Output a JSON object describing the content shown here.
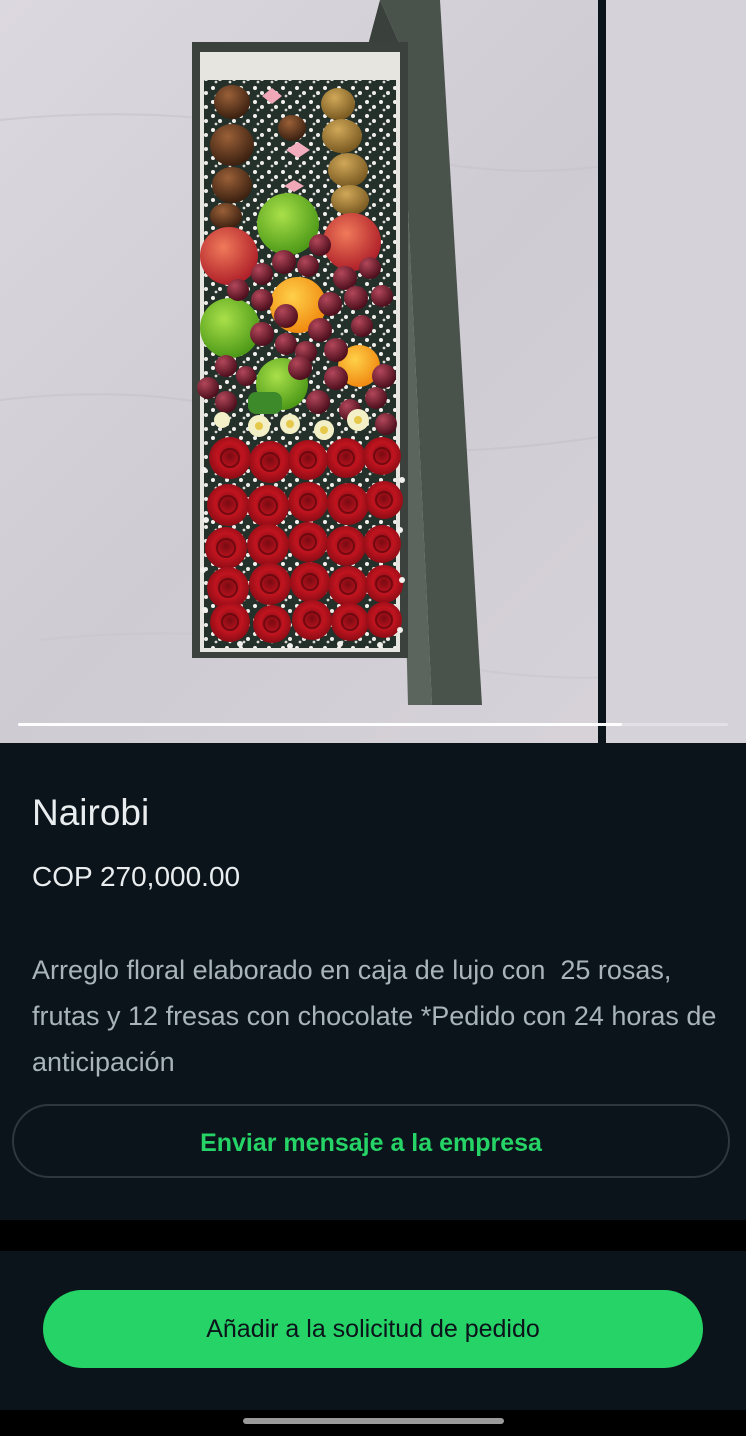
{
  "product": {
    "name": "Nairobi",
    "price": "COP 270,000.00",
    "description": "Arreglo floral elaborado en caja de lujo con  25 rosas, frutas y 12 fresas con chocolate *Pedido con 24 horas de anticipación"
  },
  "actions": {
    "message_label": "Enviar mensaje a la empresa",
    "add_label": "Añadir a la solicitud de pedido"
  },
  "gallery": {
    "images_count": 2,
    "current_index": 1,
    "progress_fraction": 0.85
  },
  "colors": {
    "background": "#0b141a",
    "accent": "#25d366",
    "text_primary": "#e9edef",
    "text_secondary": "#a8b3ba"
  }
}
